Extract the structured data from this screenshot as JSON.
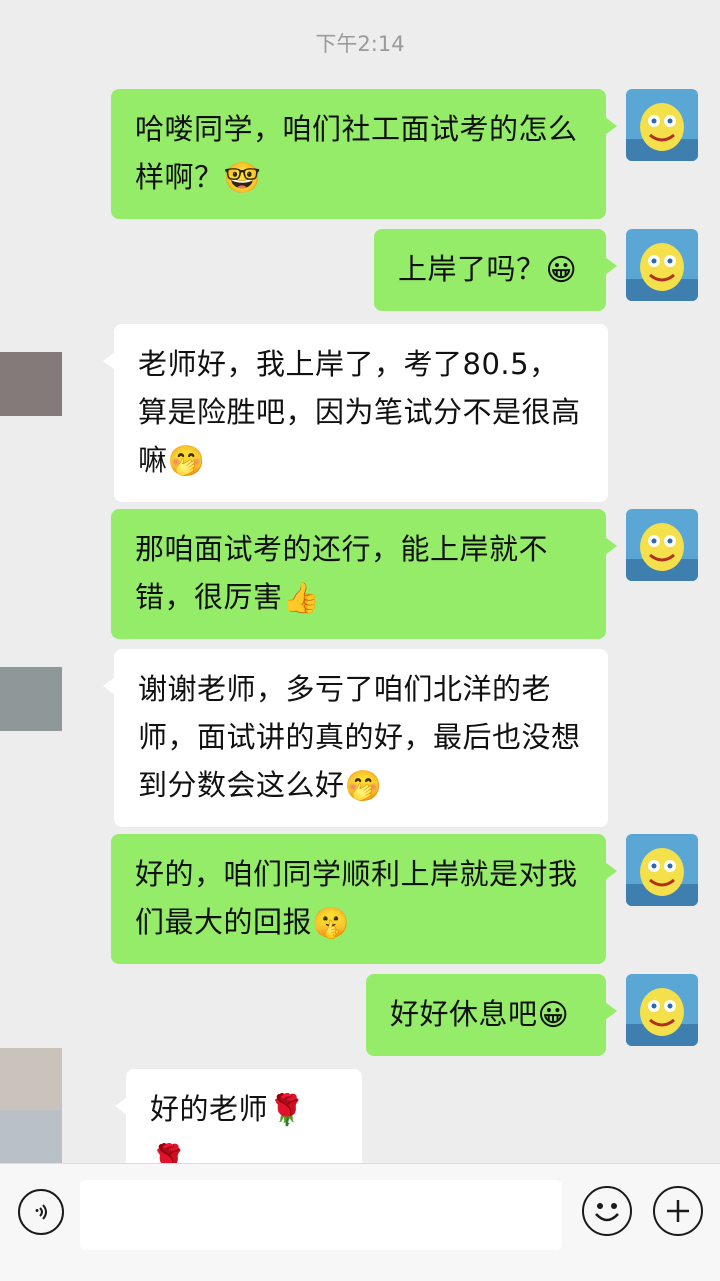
{
  "timestamp": "下午2:14",
  "messages": [
    {
      "from": "self",
      "text": "哈喽同学，咱们社工面试考的怎么样啊？",
      "emoji": "🤓"
    },
    {
      "from": "self",
      "text": "上岸了吗？",
      "emoji": "😀"
    },
    {
      "from": "other",
      "text": "老师好，我上岸了，考了80.5，算是险胜吧，因为笔试分不是很高嘛",
      "emoji": "🤭"
    },
    {
      "from": "self",
      "text": "那咱面试考的还行，能上岸就不错，很厉害",
      "emoji": "👍"
    },
    {
      "from": "other",
      "text": "谢谢老师，多亏了咱们北洋的老师，面试讲的真的好，最后也没想到分数会这么好",
      "emoji": "🤭"
    },
    {
      "from": "self",
      "text": "好的，咱们同学顺利上岸就是对我们最大的回报",
      "emoji": "🤫"
    },
    {
      "from": "self",
      "text": "好好休息吧",
      "emoji": "😀"
    },
    {
      "from": "other",
      "text": "好的老师",
      "emoji": "🌹 🌹"
    }
  ],
  "icons": {
    "voice": "voice-icon",
    "emoji_button": "emoji-face-icon",
    "plus": "plus-icon"
  },
  "colors": {
    "outgoing_bubble": "#95ec69",
    "incoming_bubble": "#ffffff",
    "background": "#ededed"
  }
}
